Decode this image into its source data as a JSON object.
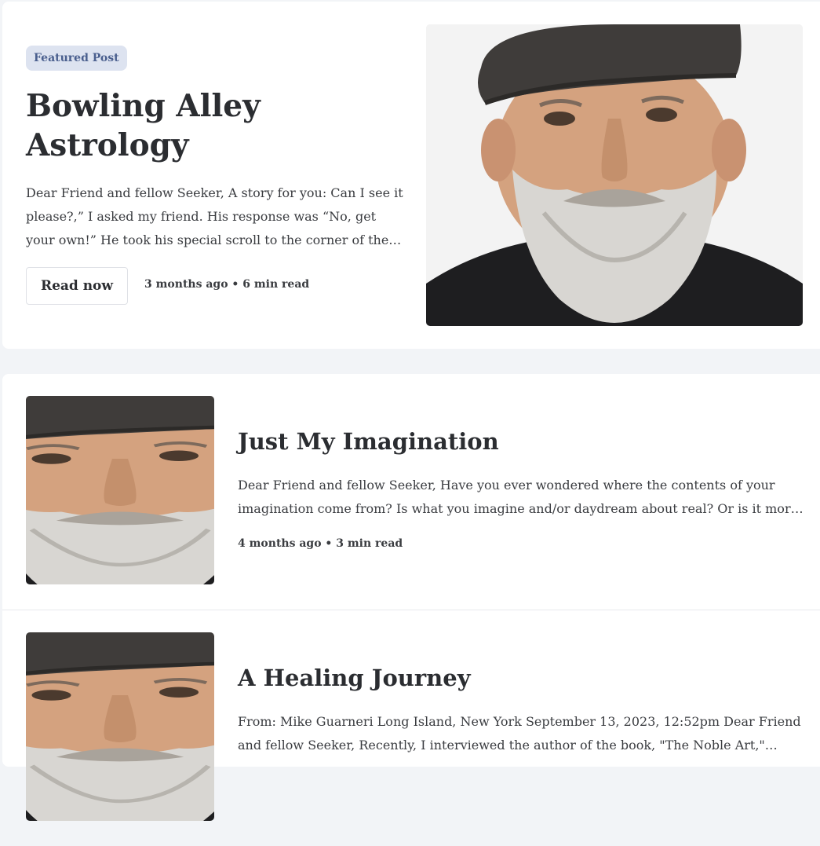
{
  "featured": {
    "badge": "Featured Post",
    "title": "Bowling Alley Astrology",
    "excerpt": "Dear Friend and fellow Seeker, A story for you: Can I see it please?,” I asked my friend. His response was “No, get your own!” He took his special scroll to the corner of the lobby to look at it more closely and privately.",
    "button_label": "Read now",
    "meta": "3 months ago • 6 min read",
    "image_icon": "portrait-photo"
  },
  "posts": [
    {
      "title": "Just My Imagination",
      "excerpt": "Dear Friend and fellow Seeker, Have you ever wondered where the contents of your imagination come from? Is what you imagine and/or daydream about real? Or is it more your own creation?",
      "meta": "4 months ago • 3 min read",
      "image_icon": "portrait-photo"
    },
    {
      "title": "A Healing Journey",
      "excerpt": "From: Mike Guarneri Long Island, New York September 13, 2023, 12:52pm Dear Friend and fellow Seeker, Recently, I interviewed the author of the book, \"The Noble Art,\" Tiffany Lazic, who is a psychotherapist.",
      "meta": "",
      "image_icon": "portrait-photo"
    }
  ],
  "colors": {
    "page_background": "#f2f4f7",
    "card_background": "#ffffff",
    "badge_background": "#dde3f0",
    "badge_text": "#4a5f8e",
    "text": "#2b2d31"
  }
}
